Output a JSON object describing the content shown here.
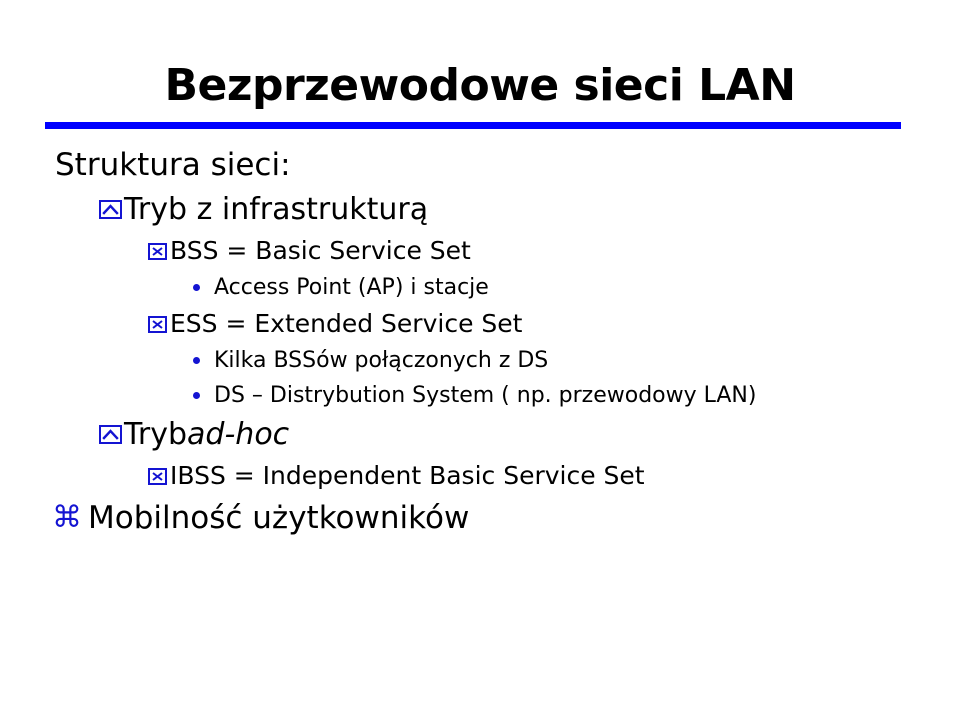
{
  "slide": {
    "title": "Bezprzewodowe sieci LAN",
    "title_rule_color": "#0000ff",
    "background_color": "#ffffff",
    "text_color": "#000000",
    "bullet_color": "#1414d2",
    "body": [
      {
        "level": 0,
        "bullet": "none",
        "text": "Struktura sieci:"
      },
      {
        "level": 1,
        "bullet": "box-caret-icon",
        "text": "Tryb z infrastrukturą"
      },
      {
        "level": 2,
        "bullet": "box-x-icon",
        "text": "BSS = Basic Service Set"
      },
      {
        "level": 3,
        "bullet": "dot-icon",
        "text": "Access Point (AP) i stacje"
      },
      {
        "level": 2,
        "bullet": "box-x-icon",
        "text": "ESS = Extended Service Set"
      },
      {
        "level": 3,
        "bullet": "dot-icon",
        "text": "Kilka BSSów połączonych z DS"
      },
      {
        "level": 3,
        "bullet": "dot-icon",
        "text": "DS – Distrybution System ( np. przewodowy LAN)"
      },
      {
        "level": 1,
        "bullet": "box-caret-icon",
        "text_regular": "Tryb ",
        "text_italic": "ad-hoc"
      },
      {
        "level": 2,
        "bullet": "box-x-icon",
        "text": "IBSS = Independent Basic Service Set"
      },
      {
        "level": "top",
        "bullet": "command-icon",
        "bullet_glyph": "⌘",
        "text": "Mobilność użytkowników"
      }
    ]
  }
}
